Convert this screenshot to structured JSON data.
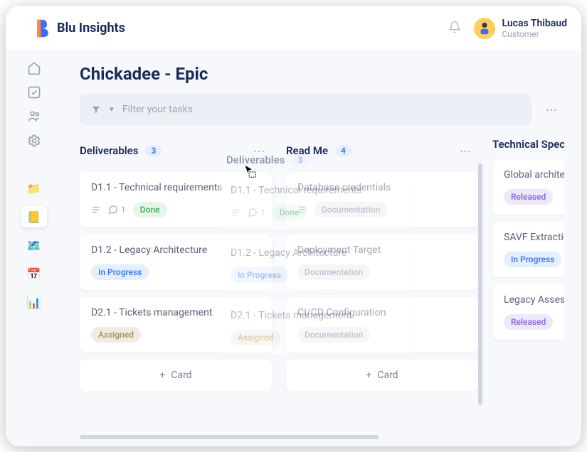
{
  "brand": "Blu Insights",
  "user": {
    "name": "Lucas Thibaud",
    "role": "Customer"
  },
  "page": {
    "title": "Chickadee - Epic"
  },
  "filter": {
    "placeholder": "Filter your tasks"
  },
  "more_label": "⋯",
  "add_card_label": "Card",
  "columns": [
    {
      "title": "Deliverables",
      "count": "3",
      "cards": [
        {
          "title": "D1.1 - Technical requirements",
          "icons": [
            "desc",
            "comment"
          ],
          "comment_count": "1",
          "tag": "Done",
          "tag_class": "done"
        },
        {
          "title": "D1.2 - Legacy Architecture",
          "tag": "In Progress",
          "tag_class": "progress"
        },
        {
          "title": "D2.1 - Tickets management",
          "tag": "Assigned",
          "tag_class": "assigned"
        }
      ]
    },
    {
      "title": "Read Me",
      "count": "4",
      "cards": [
        {
          "title": "Database credentials",
          "icons": [
            "desc"
          ],
          "tag": "Documentation",
          "tag_class": "doc"
        },
        {
          "title": "Deployment Target",
          "tag": "Documentation",
          "tag_class": "doc"
        },
        {
          "title": "CI/CD Configuration",
          "tag": "Documentation",
          "tag_class": "doc"
        }
      ]
    },
    {
      "title": "Technical Spec",
      "count": "",
      "cards": [
        {
          "title": "Global architecture",
          "tag": "Released",
          "tag_class": "released"
        },
        {
          "title": "SAVF Extraction",
          "tag": "In Progress",
          "tag_class": "progress"
        },
        {
          "title": "Legacy Assessment",
          "tag": "Released",
          "tag_class": "released"
        }
      ]
    }
  ],
  "ghost": {
    "title": "Deliverables",
    "count": "3",
    "cards": [
      {
        "title": "D1.1 - Technical requirements",
        "comment_count": "1",
        "tag": "Done"
      },
      {
        "title": "D1.2 - Legacy Architecture",
        "tag": "In Progress"
      },
      {
        "title": "D2.1 - Tickets management",
        "tag": "Assigned"
      }
    ]
  },
  "nav_icons": [
    "home",
    "check",
    "users",
    "gear"
  ],
  "nav_tiles": [
    {
      "name": "folder",
      "emoji": "📁",
      "active": false
    },
    {
      "name": "notes",
      "emoji": "📒",
      "active": true
    },
    {
      "name": "map",
      "emoji": "🗺️",
      "active": false
    },
    {
      "name": "calendar",
      "emoji": "📅",
      "active": false
    },
    {
      "name": "chart",
      "emoji": "📊",
      "active": false
    }
  ]
}
